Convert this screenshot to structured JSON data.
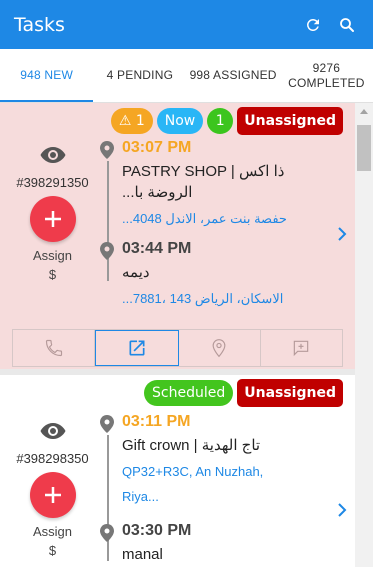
{
  "header": {
    "title": "Tasks",
    "refresh_icon": "refresh-icon",
    "search_icon": "search-icon",
    "color": "#1e88e5"
  },
  "tabs": [
    {
      "label": "948 NEW",
      "active": true
    },
    {
      "label": "4 PENDING",
      "active": false
    },
    {
      "label": "998 ASSIGNED",
      "active": false
    },
    {
      "label": "9276\nCOMPLETED",
      "active": false
    }
  ],
  "tasks": [
    {
      "badges": {
        "warning": "⚠ 1",
        "now": "Now",
        "count": "1",
        "status": "Unassigned"
      },
      "order_id": "#398291350",
      "assign_label": "Assign",
      "price": "$",
      "pickup": {
        "time": "03:07 PM",
        "name": "PASTRY SHOP | ذا اكس",
        "name_line2": "...الروضة با",
        "address": "...حفصة بنت عمر، الاندل 4048"
      },
      "dropoff": {
        "time": "03:44 PM",
        "name": "ديمه",
        "address": "...الاسكان، الرياض 143 ،7881"
      },
      "actions": [
        "phone-icon",
        "open-external-icon",
        "location-pin-icon",
        "comment-icon"
      ],
      "background": "#f6dcdc"
    },
    {
      "badges": {
        "scheduled": "Scheduled",
        "status": "Unassigned"
      },
      "order_id": "#398298350",
      "assign_label": "Assign",
      "price": "$",
      "pickup": {
        "time": "03:11 PM",
        "name": "Gift crown | تاج الهدية",
        "address_line1": "QP32+R3C, An Nuzhah,",
        "address_line2": "Riya..."
      },
      "dropoff": {
        "time": "03:30 PM",
        "name": "manal"
      }
    }
  ]
}
